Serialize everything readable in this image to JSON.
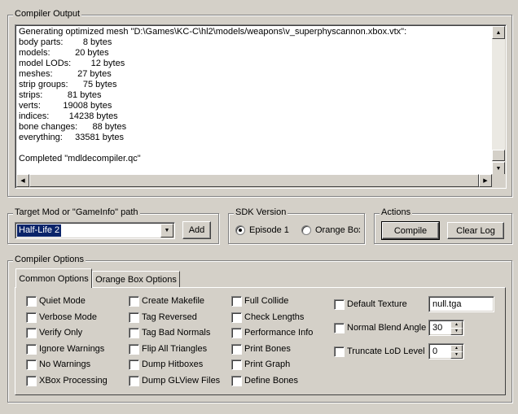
{
  "compiler_output": {
    "title": "Compiler Output",
    "lines": [
      "Generating optimized mesh \"D:\\Games\\KC-C\\hl2\\models/weapons\\v_superphyscannon.xbox.vtx\":",
      "body parts:        8 bytes",
      "models:          20 bytes",
      "model LODs:        12 bytes",
      "meshes:          27 bytes",
      "strip groups:      75 bytes",
      "strips:          81 bytes",
      "verts:         19008 bytes",
      "indices:        14238 bytes",
      "bone changes:      88 bytes",
      "everything:     33581 bytes",
      "",
      "Completed \"mdldecompiler.qc\""
    ]
  },
  "target": {
    "title": "Target Mod or \"GameInfo\" path",
    "value": "Half-Life 2",
    "add_label": "Add"
  },
  "sdk": {
    "title": "SDK Version",
    "episode1": "Episode 1",
    "orangebox": "Orange Box"
  },
  "actions": {
    "title": "Actions",
    "compile": "Compile",
    "clear_log": "Clear Log"
  },
  "options": {
    "title": "Compiler Options",
    "tab_common": "Common Options",
    "tab_orange": "Orange Box Options",
    "col1": [
      "Quiet Mode",
      "Verbose Mode",
      "Verify Only",
      "Ignore Warnings",
      "No Warnings",
      "XBox Processing"
    ],
    "col2": [
      "Create Makefile",
      "Tag Reversed",
      "Tag Bad Normals",
      "Flip All Triangles",
      "Dump Hitboxes",
      "Dump GLView Files"
    ],
    "col3": [
      "Full Collide",
      "Check Lengths",
      "Performance Info",
      "Print Bones",
      "Print Graph",
      "Define Bones"
    ],
    "default_texture_label": "Default Texture",
    "default_texture_value": "null.tga",
    "normal_blend_label": "Normal Blend Angle",
    "normal_blend_value": "30",
    "truncate_lod_label": "Truncate LoD Level",
    "truncate_lod_value": "0"
  }
}
